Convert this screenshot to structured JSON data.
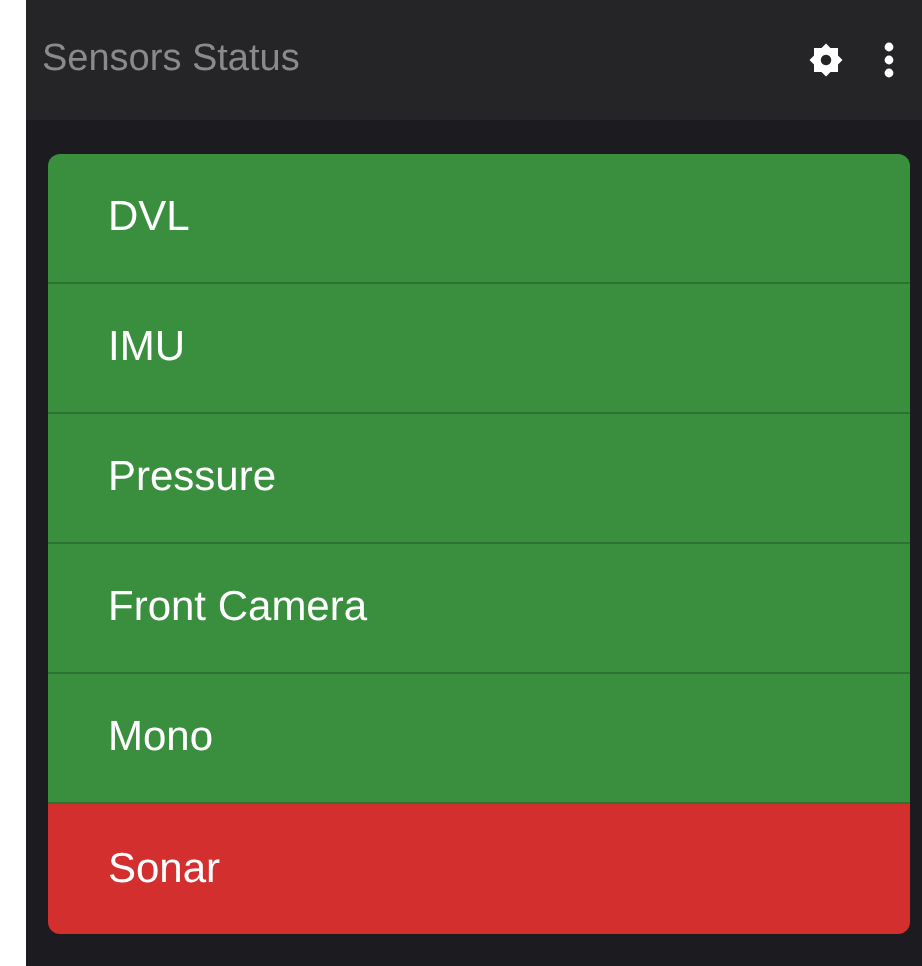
{
  "header": {
    "title": "Sensors Status"
  },
  "sensors": [
    {
      "name": "DVL",
      "color": "#3a8f3f"
    },
    {
      "name": "IMU",
      "color": "#3a8f3f"
    },
    {
      "name": "Pressure",
      "color": "#3a8f3f"
    },
    {
      "name": "Front Camera",
      "color": "#3a8f3f"
    },
    {
      "name": "Mono",
      "color": "#3a8f3f"
    },
    {
      "name": "Sonar",
      "color": "#d32f2f"
    }
  ]
}
